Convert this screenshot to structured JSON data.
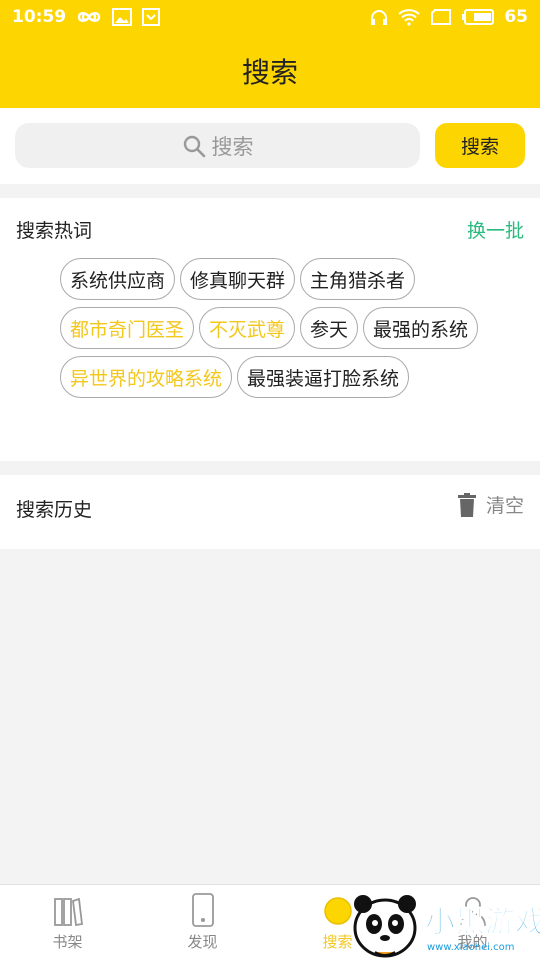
{
  "status": {
    "time": "10:59",
    "battery": "65"
  },
  "title": "搜索",
  "search": {
    "placeholder": "搜索",
    "button": "搜索"
  },
  "hot": {
    "header": "搜索热词",
    "refresh": "换一批",
    "tags": [
      {
        "text": "系统供应商",
        "highlight": false
      },
      {
        "text": "修真聊天群",
        "highlight": false
      },
      {
        "text": "主角猎杀者",
        "highlight": false
      },
      {
        "text": "都市奇门医圣",
        "highlight": true
      },
      {
        "text": "不灭武尊",
        "highlight": true
      },
      {
        "text": "参天",
        "highlight": false
      },
      {
        "text": "最强的系统",
        "highlight": false
      },
      {
        "text": "异世界的攻略系统",
        "highlight": true
      },
      {
        "text": "最强装逼打脸系统",
        "highlight": false
      }
    ]
  },
  "history": {
    "label": "搜索历史",
    "clear": "清空"
  },
  "tabs": [
    {
      "label": "书架",
      "icon": "bookshelf-icon"
    },
    {
      "label": "发现",
      "icon": "phone-icon"
    },
    {
      "label": "搜索",
      "icon": "search-icon",
      "active": true
    },
    {
      "label": "我的",
      "icon": "user-icon"
    }
  ],
  "watermark": {
    "text": "小黑游戏",
    "url": "www.xiaohei.com"
  },
  "colors": {
    "accent": "#fdd601",
    "highlight_text": "#f3c71c",
    "refresh": "#2bba7f"
  }
}
